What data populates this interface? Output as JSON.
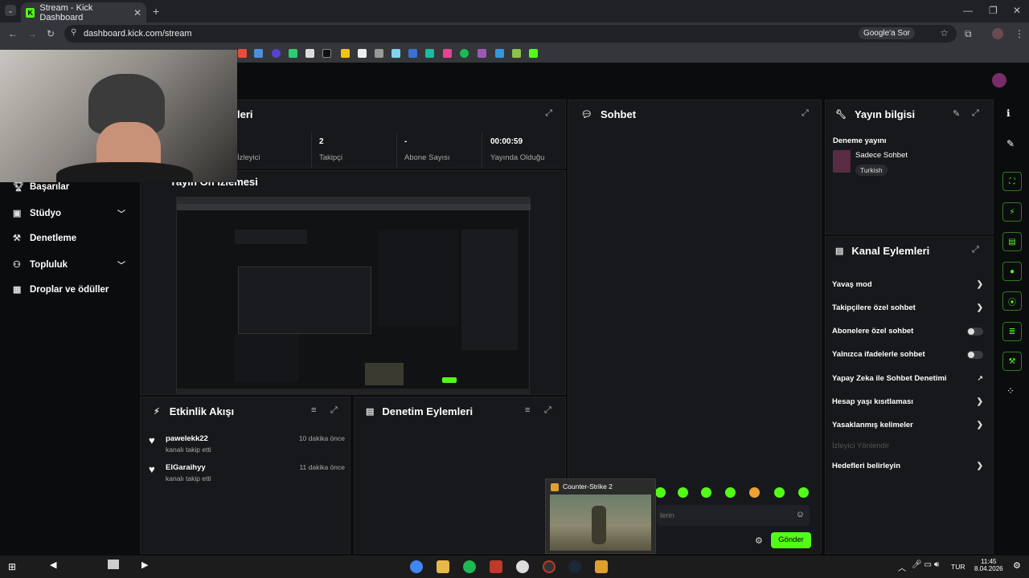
{
  "browser": {
    "tab_title": "Stream - Kick Dashboard",
    "url": "dashboard.kick.com/stream",
    "google_ask": "Google'a Sor"
  },
  "sidebar": {
    "items": [
      {
        "label": "Başarılar",
        "icon": "trophy-icon",
        "chevron": false
      },
      {
        "label": "Stüdyo",
        "icon": "video-icon",
        "chevron": true
      },
      {
        "label": "Denetleme",
        "icon": "gavel-icon",
        "chevron": false
      },
      {
        "label": "Topluluk",
        "icon": "community-icon",
        "chevron": true
      },
      {
        "label": "Droplar ve ödüller",
        "icon": "gift-icon",
        "chevron": false
      }
    ]
  },
  "stats_panel": {
    "title_partial": "leri",
    "stats": [
      {
        "value": "",
        "label": "İzleyici"
      },
      {
        "value": "2",
        "label": "Takipçi"
      },
      {
        "value": "-",
        "label": "Abone Sayısı"
      },
      {
        "value": "00:00:59",
        "label": "Yayında Olduğu"
      }
    ]
  },
  "preview_panel": {
    "title_partial": "Yayın Ön İzlemesi"
  },
  "activity_panel": {
    "title": "Etkinlik Akışı",
    "items": [
      {
        "user": "pawelekk22",
        "action": "kanalı takip etti",
        "time": "10 dakika önce"
      },
      {
        "user": "ElGaraihyy",
        "action": "kanalı takip etti",
        "time": "11 dakika önce"
      }
    ]
  },
  "moderation_panel": {
    "title": "Denetim Eylemleri"
  },
  "chat_panel": {
    "title": "Sohbet",
    "input_placeholder_partial": "lerin",
    "send_label": "Gönder"
  },
  "stream_info": {
    "title": "Yayın bilgisi",
    "stream_title": "Deneme yayını",
    "category": "Sadece Sohbet",
    "language": "Turkish"
  },
  "channel_actions": {
    "title": "Kanal Eylemleri",
    "items": [
      {
        "label": "Yavaş mod",
        "control": "chevron"
      },
      {
        "label": "Takipçilere özel sohbet",
        "control": "chevron"
      },
      {
        "label": "Abonelere özel sohbet",
        "control": "toggle"
      },
      {
        "label": "Yalnızca ifadelerle sohbet",
        "control": "toggle"
      },
      {
        "label": "Yapay Zeka ile Sohbet Denetimi",
        "control": "external"
      },
      {
        "label": "Hesap yaşı kısıtlaması",
        "control": "chevron"
      },
      {
        "label": "Yasaklanmış kelimeler",
        "control": "chevron"
      },
      {
        "label": "İzleyici Yönlendir",
        "control": "none",
        "disabled": true
      },
      {
        "label": "Hedefleri belirleyin",
        "control": "chevron"
      }
    ]
  },
  "taskbar_preview": {
    "title": "Counter-Strike 2"
  },
  "taskbar": {
    "time": "11:45",
    "date": "8.04.2026",
    "lang": "TUR"
  },
  "colors": {
    "accent": "#53fc18",
    "panel": "#17181b",
    "background": "#0b0c0e"
  }
}
